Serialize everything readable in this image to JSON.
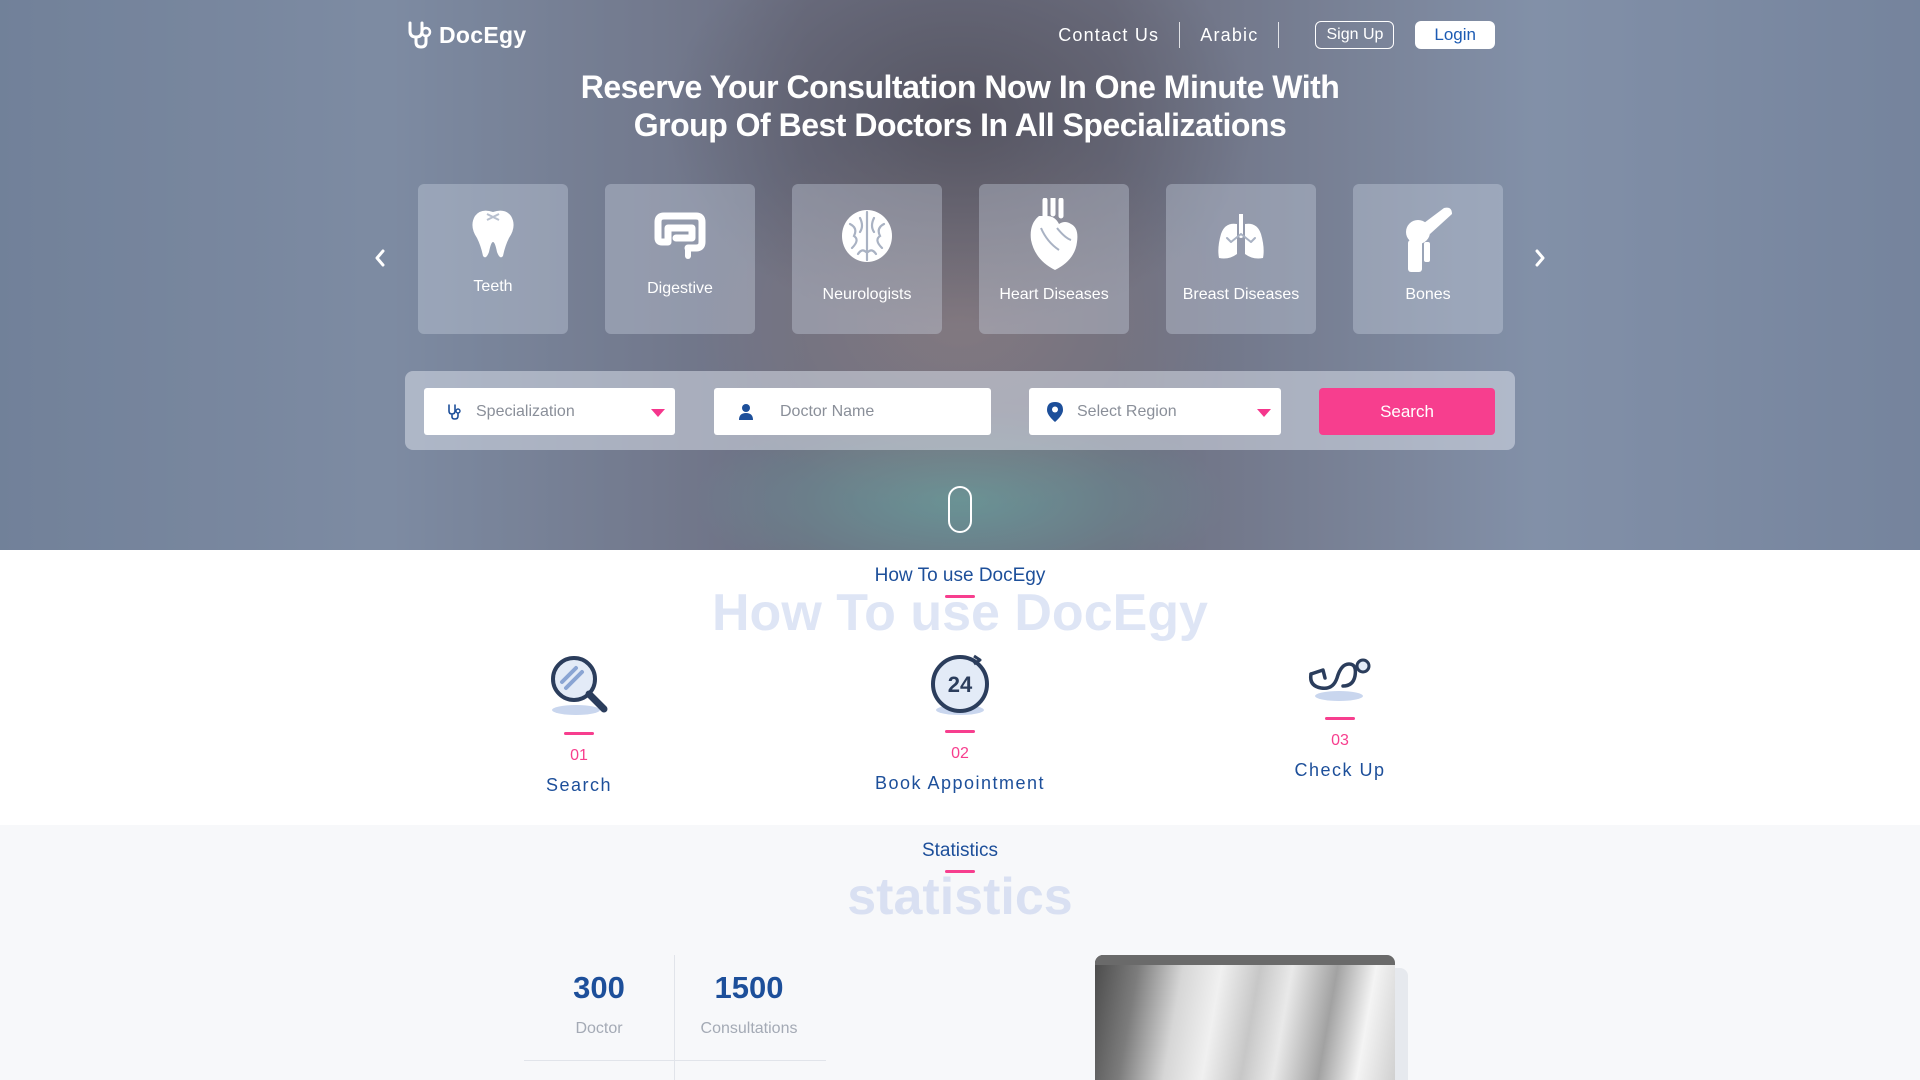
{
  "brand": {
    "name": "DocEgy"
  },
  "nav": {
    "contact": "Contact Us",
    "language": "Arabic",
    "signup": "Sign Up",
    "login": "Login"
  },
  "hero": {
    "title_line1": "Reserve Your Consultation Now In One Minute With",
    "title_line2": "Group Of Best Doctors In All Specializations"
  },
  "specialties": [
    {
      "label": "Teeth",
      "icon": "tooth-icon"
    },
    {
      "label": "Digestive",
      "icon": "intestine-icon"
    },
    {
      "label": "Neurologists",
      "icon": "brain-icon"
    },
    {
      "label": "Heart Diseases",
      "icon": "heart-icon"
    },
    {
      "label": "Breast Diseases",
      "icon": "lungs-icon"
    },
    {
      "label": "Bones",
      "icon": "bone-joint-icon"
    }
  ],
  "search": {
    "specialization_placeholder": "Specialization",
    "doctor_placeholder": "Doctor Name",
    "region_placeholder": "Select Region",
    "button": "Search"
  },
  "how_to": {
    "title": "How To use DocEgy",
    "ghost": "How To use DocEgy",
    "steps": [
      {
        "num": "01",
        "label": "Search",
        "icon": "magnifier-icon"
      },
      {
        "num": "02",
        "label": "Book Appointment",
        "icon": "clock-24-icon"
      },
      {
        "num": "03",
        "label": "Check Up",
        "icon": "stethoscope-icon"
      }
    ]
  },
  "statistics": {
    "title": "Statistics",
    "ghost": "statistics",
    "items": [
      {
        "value": "300",
        "label": "Doctor"
      },
      {
        "value": "1500",
        "label": "Consultations"
      }
    ]
  },
  "colors": {
    "accent": "#f73e8e",
    "primary": "#1d4f9a"
  }
}
